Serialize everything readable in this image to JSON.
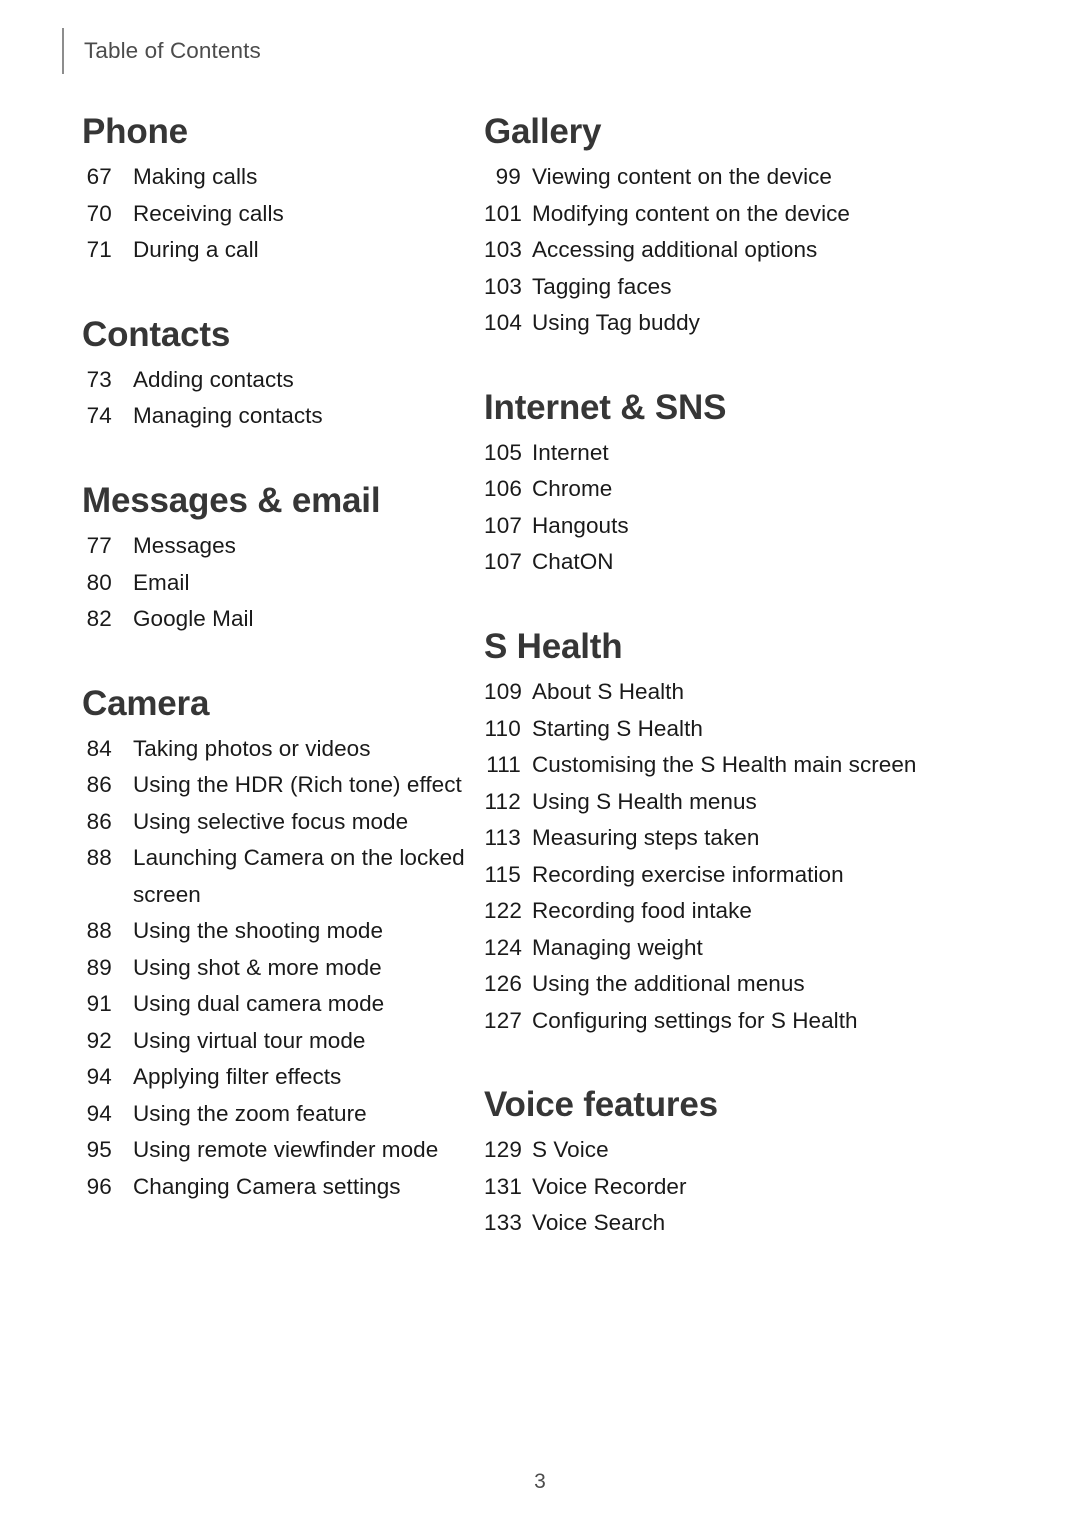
{
  "header": {
    "title": "Table of Contents"
  },
  "folio": {
    "page_number": "3"
  },
  "colors": {
    "heading": "#363636",
    "body": "#1a1a1a",
    "header_text": "#4c4c4c",
    "rule": "#8d8d8d",
    "background": "#ffffff"
  },
  "columns": {
    "left": [
      {
        "title": "Phone",
        "entries": [
          {
            "page": "67",
            "label": "Making calls"
          },
          {
            "page": "70",
            "label": "Receiving calls"
          },
          {
            "page": "71",
            "label": "During a call"
          }
        ]
      },
      {
        "title": "Contacts",
        "entries": [
          {
            "page": "73",
            "label": "Adding contacts"
          },
          {
            "page": "74",
            "label": "Managing contacts"
          }
        ]
      },
      {
        "title": "Messages & email",
        "entries": [
          {
            "page": "77",
            "label": "Messages"
          },
          {
            "page": "80",
            "label": "Email"
          },
          {
            "page": "82",
            "label": "Google Mail"
          }
        ]
      },
      {
        "title": "Camera",
        "entries": [
          {
            "page": "84",
            "label": "Taking photos or videos"
          },
          {
            "page": "86",
            "label": "Using the HDR (Rich tone) effect"
          },
          {
            "page": "86",
            "label": "Using selective focus mode"
          },
          {
            "page": "88",
            "label": "Launching Camera on the locked screen"
          },
          {
            "page": "88",
            "label": "Using the shooting mode"
          },
          {
            "page": "89",
            "label": "Using shot & more mode"
          },
          {
            "page": "91",
            "label": "Using dual camera mode"
          },
          {
            "page": "92",
            "label": "Using virtual tour mode"
          },
          {
            "page": "94",
            "label": "Applying filter effects"
          },
          {
            "page": "94",
            "label": "Using the zoom feature"
          },
          {
            "page": "95",
            "label": "Using remote viewfinder mode"
          },
          {
            "page": "96",
            "label": "Changing Camera settings"
          }
        ]
      }
    ],
    "right": [
      {
        "title": "Gallery",
        "entries": [
          {
            "page": "99",
            "label": "Viewing content on the device"
          },
          {
            "page": "101",
            "label": "Modifying content on the device"
          },
          {
            "page": "103",
            "label": "Accessing additional options"
          },
          {
            "page": "103",
            "label": "Tagging faces"
          },
          {
            "page": "104",
            "label": "Using Tag buddy"
          }
        ]
      },
      {
        "title": "Internet & SNS",
        "entries": [
          {
            "page": "105",
            "label": "Internet"
          },
          {
            "page": "106",
            "label": "Chrome"
          },
          {
            "page": "107",
            "label": "Hangouts"
          },
          {
            "page": "107",
            "label": "ChatON"
          }
        ]
      },
      {
        "title": "S Health",
        "entries": [
          {
            "page": "109",
            "label": "About S Health"
          },
          {
            "page": "110",
            "label": "Starting S Health"
          },
          {
            "page": "111",
            "label": "Customising the S Health main screen"
          },
          {
            "page": "112",
            "label": "Using S Health menus"
          },
          {
            "page": "113",
            "label": "Measuring steps taken"
          },
          {
            "page": "115",
            "label": "Recording exercise information"
          },
          {
            "page": "122",
            "label": "Recording food intake"
          },
          {
            "page": "124",
            "label": "Managing weight"
          },
          {
            "page": "126",
            "label": "Using the additional menus"
          },
          {
            "page": "127",
            "label": "Configuring settings for S Health"
          }
        ]
      },
      {
        "title": "Voice features",
        "entries": [
          {
            "page": "129",
            "label": "S Voice"
          },
          {
            "page": "131",
            "label": "Voice Recorder"
          },
          {
            "page": "133",
            "label": "Voice Search"
          }
        ]
      }
    ]
  }
}
